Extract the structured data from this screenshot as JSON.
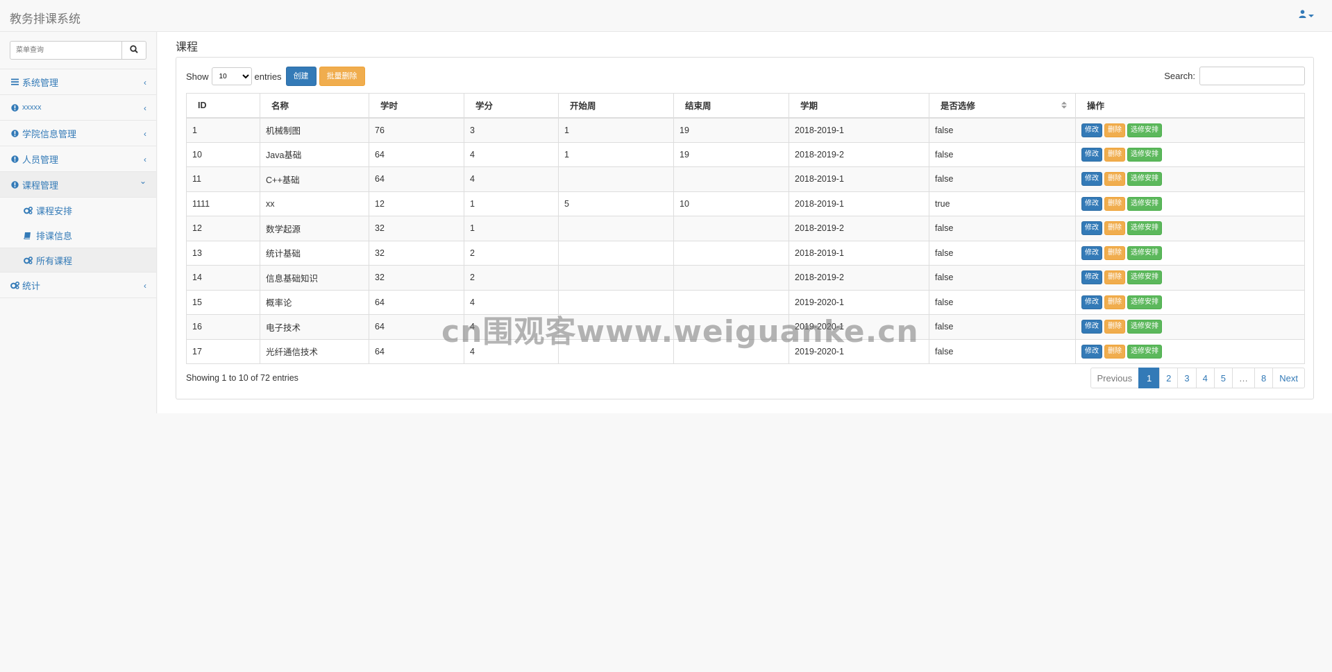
{
  "navbar": {
    "brand": "教务排课系统",
    "user_icon": "user-icon",
    "caret_icon": "caret-down-icon"
  },
  "sidebar": {
    "search_placeholder": "菜单查询",
    "search_icon": "search-icon",
    "items": [
      {
        "label": "系统管理",
        "icon": "bars-icon",
        "chevron": "‹"
      },
      {
        "label": "xxxxx",
        "icon": "info-circle-icon",
        "chevron": "‹"
      },
      {
        "label": "学院信息管理",
        "icon": "info-circle-icon",
        "chevron": "‹"
      },
      {
        "label": "人员管理",
        "icon": "info-circle-icon",
        "chevron": "‹"
      },
      {
        "label": "课程管理",
        "icon": "info-circle-icon",
        "chevron": "⌄"
      }
    ],
    "subitems": [
      {
        "label": "课程安排",
        "icon": "gears-icon"
      },
      {
        "label": "排课信息",
        "icon": "book-icon"
      },
      {
        "label": "所有课程",
        "icon": "gears-icon"
      }
    ],
    "stats": {
      "label": "统计",
      "icon": "gears-icon",
      "chevron": "‹"
    }
  },
  "main": {
    "title": "课程",
    "show_label": "Show",
    "page_size": "10",
    "entries_label": "entries",
    "create_label": "创建",
    "batch_delete_label": "批量删除",
    "search_label": "Search:",
    "columns": [
      "ID",
      "名称",
      "学时",
      "学分",
      "开始周",
      "结束周",
      "学期",
      "是否选修",
      "操作"
    ],
    "rows": [
      [
        "1",
        "机械制图",
        "76",
        "3",
        "1",
        "19",
        "2018-2019-1",
        "false"
      ],
      [
        "10",
        "Java基础",
        "64",
        "4",
        "1",
        "19",
        "2018-2019-2",
        "false"
      ],
      [
        "11",
        "C++基础",
        "64",
        "4",
        "",
        "",
        "2018-2019-1",
        "false"
      ],
      [
        "1111",
        "xx",
        "12",
        "1",
        "5",
        "10",
        "2018-2019-1",
        "true"
      ],
      [
        "12",
        "数学起源",
        "32",
        "1",
        "",
        "",
        "2018-2019-2",
        "false"
      ],
      [
        "13",
        "统计基础",
        "32",
        "2",
        "",
        "",
        "2018-2019-1",
        "false"
      ],
      [
        "14",
        "信息基础知识",
        "32",
        "2",
        "",
        "",
        "2018-2019-2",
        "false"
      ],
      [
        "15",
        "概率论",
        "64",
        "4",
        "",
        "",
        "2019-2020-1",
        "false"
      ],
      [
        "16",
        "电子技术",
        "64",
        "4",
        "",
        "",
        "2019-2020-1",
        "false"
      ],
      [
        "17",
        "光纤通信技术",
        "64",
        "4",
        "",
        "",
        "2019-2020-1",
        "false"
      ]
    ],
    "row_actions": {
      "edit": "修改",
      "delete": "删除",
      "elective": "选修安排"
    },
    "showing_text": "Showing 1 to 10 of 72 entries",
    "pagination": [
      "Previous",
      "1",
      "2",
      "3",
      "4",
      "5",
      "…",
      "8",
      "Next"
    ],
    "pagination_active": "1"
  },
  "watermark": "cn围观客www.weiguanke.cn",
  "colors": {
    "primary": "#337ab7",
    "warning": "#f0ad4e",
    "success": "#5cb85c"
  }
}
